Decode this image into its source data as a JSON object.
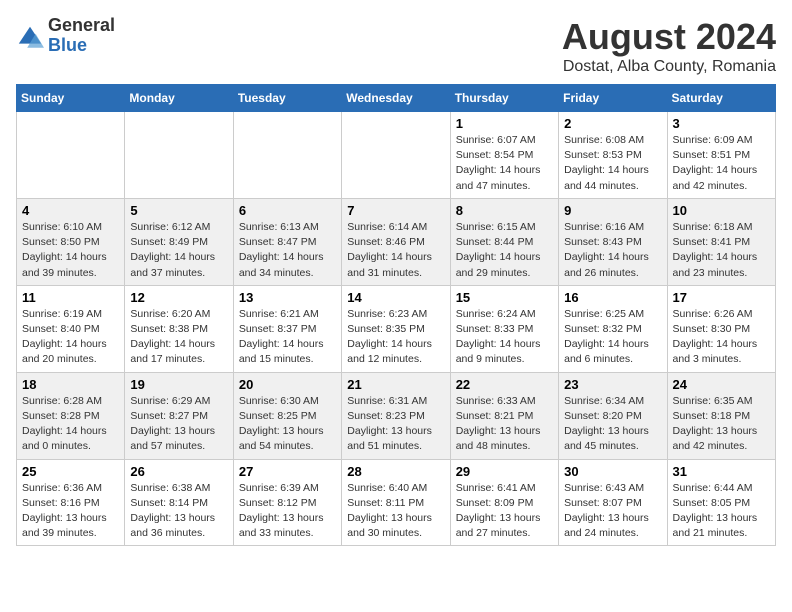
{
  "header": {
    "logo_general": "General",
    "logo_blue": "Blue",
    "month": "August 2024",
    "location": "Dostat, Alba County, Romania"
  },
  "weekdays": [
    "Sunday",
    "Monday",
    "Tuesday",
    "Wednesday",
    "Thursday",
    "Friday",
    "Saturday"
  ],
  "weeks": [
    [
      {
        "day": "",
        "info": ""
      },
      {
        "day": "",
        "info": ""
      },
      {
        "day": "",
        "info": ""
      },
      {
        "day": "",
        "info": ""
      },
      {
        "day": "1",
        "info": "Sunrise: 6:07 AM\nSunset: 8:54 PM\nDaylight: 14 hours\nand 47 minutes."
      },
      {
        "day": "2",
        "info": "Sunrise: 6:08 AM\nSunset: 8:53 PM\nDaylight: 14 hours\nand 44 minutes."
      },
      {
        "day": "3",
        "info": "Sunrise: 6:09 AM\nSunset: 8:51 PM\nDaylight: 14 hours\nand 42 minutes."
      }
    ],
    [
      {
        "day": "4",
        "info": "Sunrise: 6:10 AM\nSunset: 8:50 PM\nDaylight: 14 hours\nand 39 minutes."
      },
      {
        "day": "5",
        "info": "Sunrise: 6:12 AM\nSunset: 8:49 PM\nDaylight: 14 hours\nand 37 minutes."
      },
      {
        "day": "6",
        "info": "Sunrise: 6:13 AM\nSunset: 8:47 PM\nDaylight: 14 hours\nand 34 minutes."
      },
      {
        "day": "7",
        "info": "Sunrise: 6:14 AM\nSunset: 8:46 PM\nDaylight: 14 hours\nand 31 minutes."
      },
      {
        "day": "8",
        "info": "Sunrise: 6:15 AM\nSunset: 8:44 PM\nDaylight: 14 hours\nand 29 minutes."
      },
      {
        "day": "9",
        "info": "Sunrise: 6:16 AM\nSunset: 8:43 PM\nDaylight: 14 hours\nand 26 minutes."
      },
      {
        "day": "10",
        "info": "Sunrise: 6:18 AM\nSunset: 8:41 PM\nDaylight: 14 hours\nand 23 minutes."
      }
    ],
    [
      {
        "day": "11",
        "info": "Sunrise: 6:19 AM\nSunset: 8:40 PM\nDaylight: 14 hours\nand 20 minutes."
      },
      {
        "day": "12",
        "info": "Sunrise: 6:20 AM\nSunset: 8:38 PM\nDaylight: 14 hours\nand 17 minutes."
      },
      {
        "day": "13",
        "info": "Sunrise: 6:21 AM\nSunset: 8:37 PM\nDaylight: 14 hours\nand 15 minutes."
      },
      {
        "day": "14",
        "info": "Sunrise: 6:23 AM\nSunset: 8:35 PM\nDaylight: 14 hours\nand 12 minutes."
      },
      {
        "day": "15",
        "info": "Sunrise: 6:24 AM\nSunset: 8:33 PM\nDaylight: 14 hours\nand 9 minutes."
      },
      {
        "day": "16",
        "info": "Sunrise: 6:25 AM\nSunset: 8:32 PM\nDaylight: 14 hours\nand 6 minutes."
      },
      {
        "day": "17",
        "info": "Sunrise: 6:26 AM\nSunset: 8:30 PM\nDaylight: 14 hours\nand 3 minutes."
      }
    ],
    [
      {
        "day": "18",
        "info": "Sunrise: 6:28 AM\nSunset: 8:28 PM\nDaylight: 14 hours\nand 0 minutes."
      },
      {
        "day": "19",
        "info": "Sunrise: 6:29 AM\nSunset: 8:27 PM\nDaylight: 13 hours\nand 57 minutes."
      },
      {
        "day": "20",
        "info": "Sunrise: 6:30 AM\nSunset: 8:25 PM\nDaylight: 13 hours\nand 54 minutes."
      },
      {
        "day": "21",
        "info": "Sunrise: 6:31 AM\nSunset: 8:23 PM\nDaylight: 13 hours\nand 51 minutes."
      },
      {
        "day": "22",
        "info": "Sunrise: 6:33 AM\nSunset: 8:21 PM\nDaylight: 13 hours\nand 48 minutes."
      },
      {
        "day": "23",
        "info": "Sunrise: 6:34 AM\nSunset: 8:20 PM\nDaylight: 13 hours\nand 45 minutes."
      },
      {
        "day": "24",
        "info": "Sunrise: 6:35 AM\nSunset: 8:18 PM\nDaylight: 13 hours\nand 42 minutes."
      }
    ],
    [
      {
        "day": "25",
        "info": "Sunrise: 6:36 AM\nSunset: 8:16 PM\nDaylight: 13 hours\nand 39 minutes."
      },
      {
        "day": "26",
        "info": "Sunrise: 6:38 AM\nSunset: 8:14 PM\nDaylight: 13 hours\nand 36 minutes."
      },
      {
        "day": "27",
        "info": "Sunrise: 6:39 AM\nSunset: 8:12 PM\nDaylight: 13 hours\nand 33 minutes."
      },
      {
        "day": "28",
        "info": "Sunrise: 6:40 AM\nSunset: 8:11 PM\nDaylight: 13 hours\nand 30 minutes."
      },
      {
        "day": "29",
        "info": "Sunrise: 6:41 AM\nSunset: 8:09 PM\nDaylight: 13 hours\nand 27 minutes."
      },
      {
        "day": "30",
        "info": "Sunrise: 6:43 AM\nSunset: 8:07 PM\nDaylight: 13 hours\nand 24 minutes."
      },
      {
        "day": "31",
        "info": "Sunrise: 6:44 AM\nSunset: 8:05 PM\nDaylight: 13 hours\nand 21 minutes."
      }
    ]
  ]
}
